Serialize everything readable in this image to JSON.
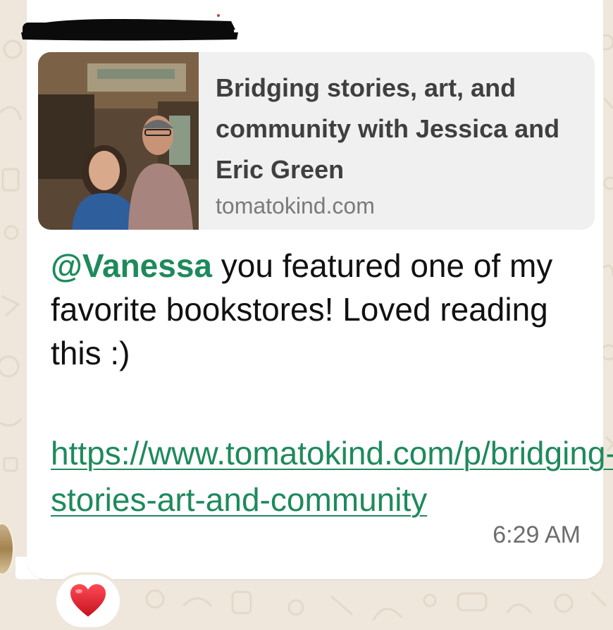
{
  "message": {
    "sender": "",
    "link_preview": {
      "title": "Bridging stories, art, and community with Jessica and Eric Green",
      "domain": "tomatokind.com"
    },
    "mention": "@Vanessa",
    "text": " you featured one of my favorite bookstores! Loved reading this :)",
    "link": "https://www.tomatokind.com/p/bridging-stories-art-and-community",
    "time": "6:29 AM",
    "reaction": "heart-emoji"
  },
  "colors": {
    "background": "#efe7dc",
    "bubble": "#ffffff",
    "preview_card": "#f1f0f0",
    "mention": "#1e8a5c",
    "link": "#1e8a5c",
    "timestamp": "#6d6d6d",
    "heart": "#e0202e"
  }
}
